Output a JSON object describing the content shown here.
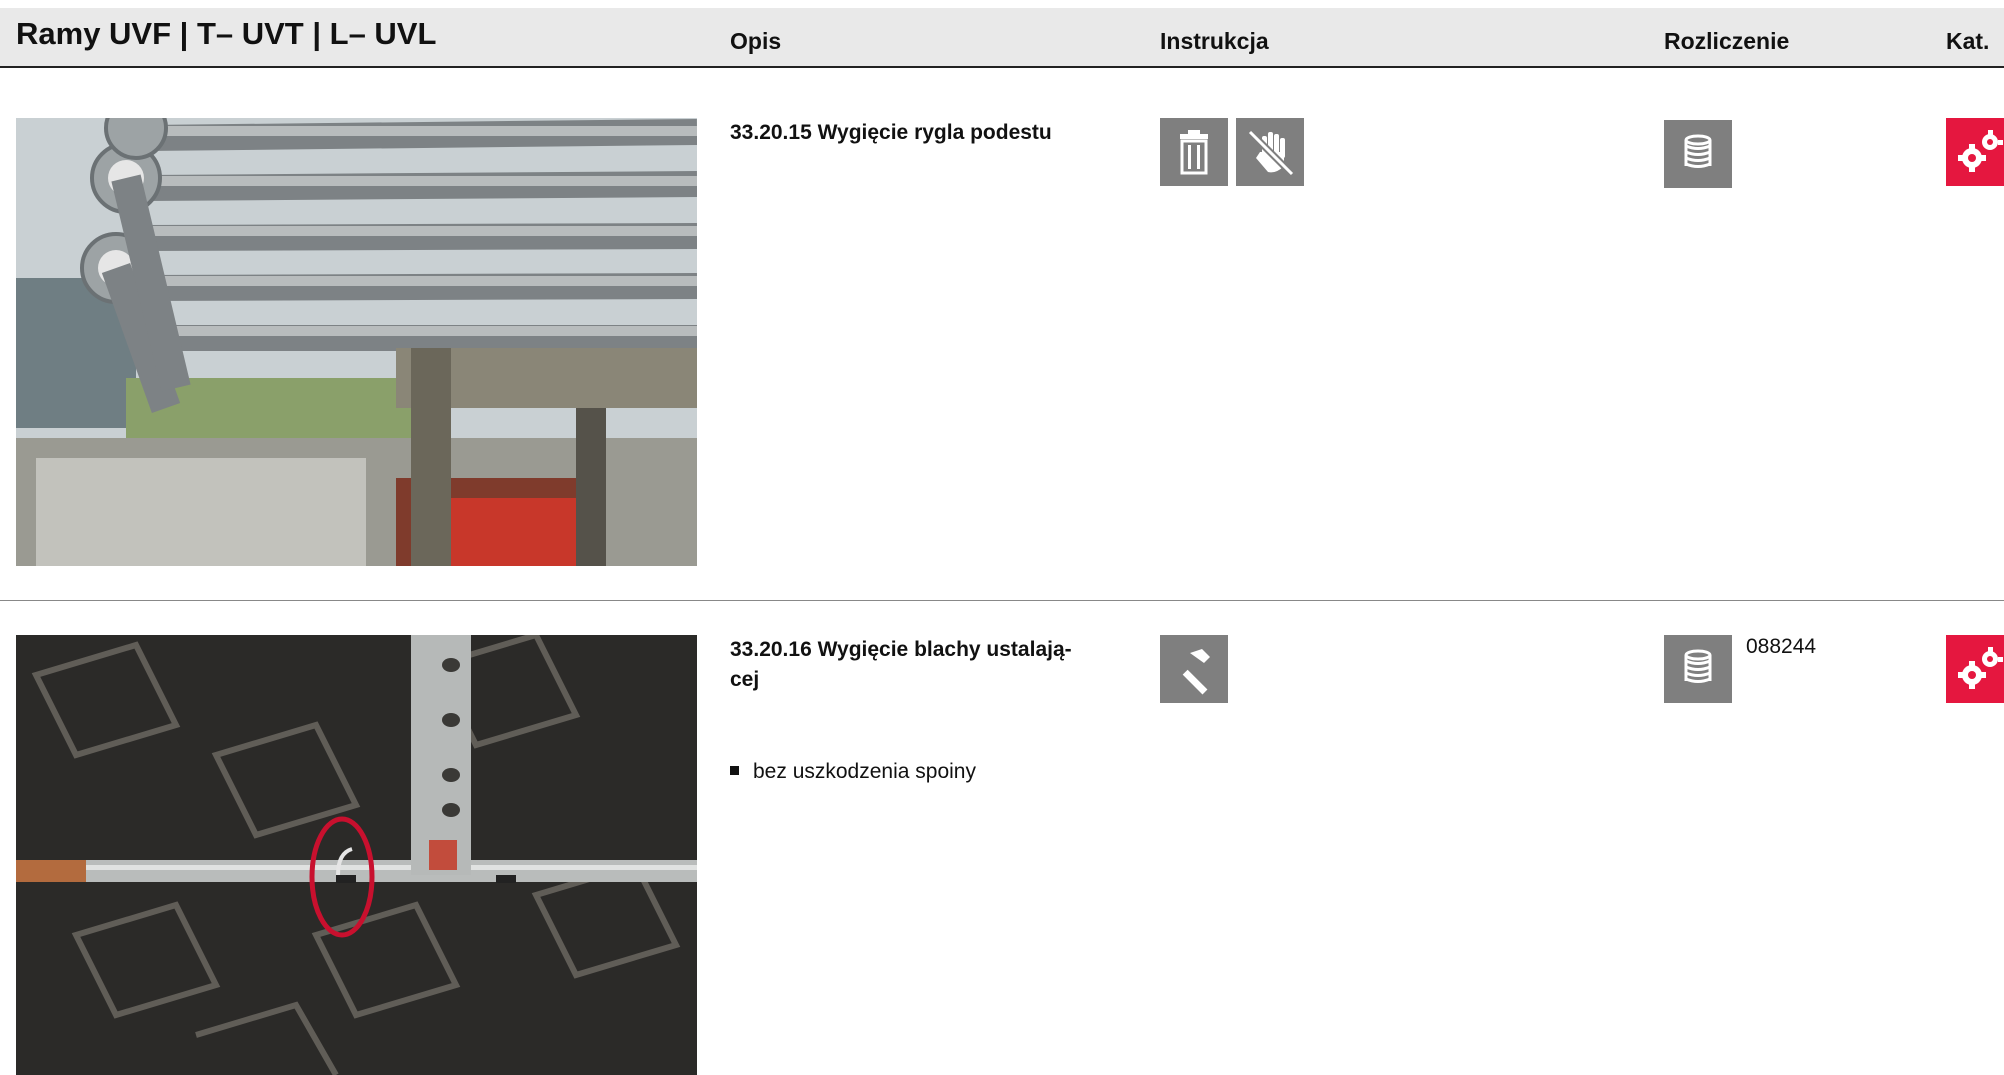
{
  "header": {
    "title": "Ramy UVF | T– UVT | L– UVL",
    "col_opis": "Opis",
    "col_instrukcja": "Instrukcja",
    "col_rozliczenie": "Rozliczenie",
    "col_kat": "Kat."
  },
  "items": [
    {
      "title": "33.20.15 Wygięcie rygla podestu",
      "instruction_icons": [
        "trash-icon",
        "no-touch-hand-icon"
      ],
      "billing_icon": "coil-stack-icon",
      "article_number": "",
      "category_icon": "gears-icon"
    },
    {
      "title": "33.20.16 Wygięcie blachy ustalają-\ncej",
      "bullet": "bez uszkodzenia spoiny",
      "instruction_icons": [
        "hammer-icon"
      ],
      "billing_icon": "coil-stack-icon",
      "article_number": "088244",
      "category_icon": "gears-icon"
    }
  ],
  "colors": {
    "header_bg": "#e9e9e9",
    "icon_bg": "#7f7f7f",
    "category_red": "#e5173f"
  }
}
